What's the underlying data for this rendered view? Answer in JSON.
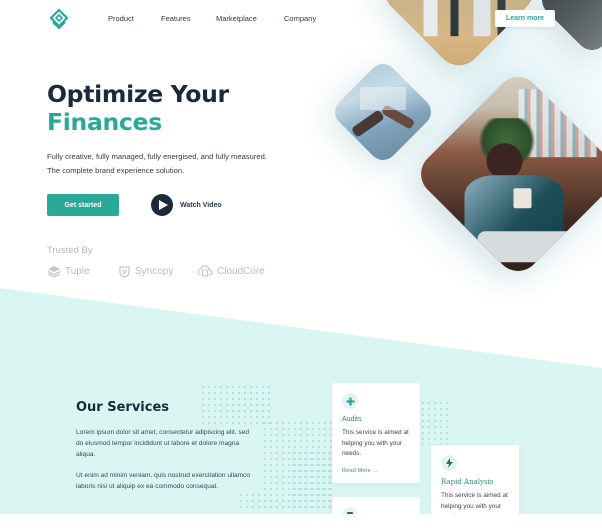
{
  "header": {
    "logo_icon": "layered-diamond-logo-icon",
    "nav": [
      "Product",
      "Features",
      "Marketplace",
      "Company"
    ],
    "cta_label": "Learn more"
  },
  "hero": {
    "title_line1": "Optimize Your",
    "title_line2": "Finances",
    "subtitle": "Fully creative, fully managed, fully energised, and fully measured. The complete brand experience solution.",
    "primary_button": "Get started",
    "video_button": "Watch Video",
    "trusted_label": "Trusted By",
    "brands": [
      {
        "name": "Tuple",
        "icon": "stack-layers-icon"
      },
      {
        "name": "Syncopy",
        "icon": "shield-v-icon"
      },
      {
        "name": "CloudCore",
        "icon": "cloud-database-icon"
      }
    ]
  },
  "services": {
    "title": "Our Services",
    "paragraph1": "Lorem ipsum dolor sit amet, consectetur adipiscing elit, sed do eiusmod tempor incididunt ut labore et dolore magna aliqua.",
    "paragraph2": "Ut enim ad minim veniam, quis nostrud exercitation ullamco laboris nisi ut aliquip ex ea commodo consequat.",
    "cards": [
      {
        "title": "Audits",
        "text": "This service is aimed at helping you with your needs.",
        "link": "Read More →",
        "icon": "gear-flower-icon"
      },
      {
        "title": "Rapid Analysis",
        "text": "This service is aimed at helping you with your needs.",
        "icon": "lightning-icon"
      },
      {
        "title": "",
        "text": "",
        "icon": "document-icon"
      }
    ]
  },
  "colors": {
    "accent": "#2aa898",
    "dark": "#1b2a3a",
    "band": "#d9f6f3"
  }
}
